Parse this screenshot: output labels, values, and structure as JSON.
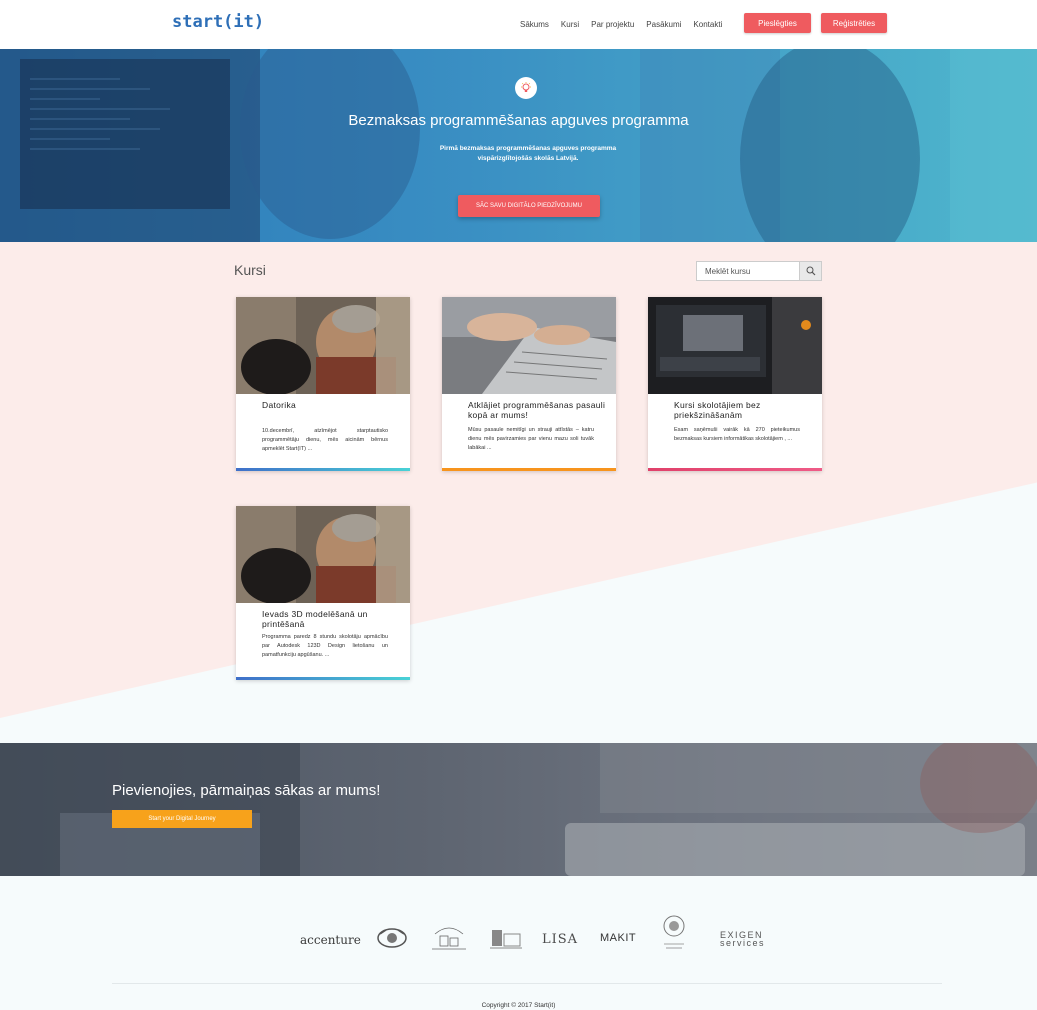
{
  "nav": {
    "logo": "start(it)",
    "links": [
      "Sākums",
      "Kursi",
      "Par projektu",
      "Pasākumi",
      "Kontakti"
    ],
    "login": "Pieslēgties",
    "register": "Reģistrēties"
  },
  "hero": {
    "title": "Bezmaksas programmēšanas apguves programma",
    "subtitle": "Pirmā bezmaksas programmēšanas apguves programma vispārizglītojošās skolās Latvijā.",
    "button": "SĀC SAVU DIGITĀLO PIEDZĪVOJUMU"
  },
  "courses": {
    "title": "Kursi",
    "search_placeholder": "Meklēt kursu",
    "cards": [
      {
        "title": "Datorika",
        "text": "10.decembrī, atzīmējot starptautisko programmētāju dienu, mēs aicinām bērnus apmeklēt Start(IT) ..."
      },
      {
        "title": "Atklājiet programmēšanas pasauli kopā ar mums!",
        "text": "Mūsu pasaule nemitīgi un strauji attīstās – katru dienu mēs pavirzamies par vienu mazu soli tuvāk labākai ..."
      },
      {
        "title": "Kursi skolotājiem bez priekšzināšanām",
        "text": "Esam saņēmuši vairāk kā 270 pieteikumus bezmaksas kursiem informātikas skolotājiem , ..."
      },
      {
        "title": "Ievads 3D modelēšanā un printēšanā",
        "text": "Programma paredz 8 stundu skolotāju apmācību par Autodesk 123D Design lietošanu un pamatfunkciju apgūšanu. ..."
      }
    ]
  },
  "join": {
    "title": "Pievienojies, pārmaiņas sākas ar mums!",
    "button": "Start your Digital Journey"
  },
  "partners": {
    "accenture": "accenture",
    "lisa": "LISA",
    "makit": "MAKIT",
    "exigen_top": "EXIGEN",
    "exigen_bottom": "services"
  },
  "footer": {
    "copyright": "Copyright © 2017 Start(it)"
  },
  "colors": {
    "accent_red": "#ef5b5f",
    "accent_orange": "#f7a21b",
    "brand_blue": "#2e6fb7"
  }
}
